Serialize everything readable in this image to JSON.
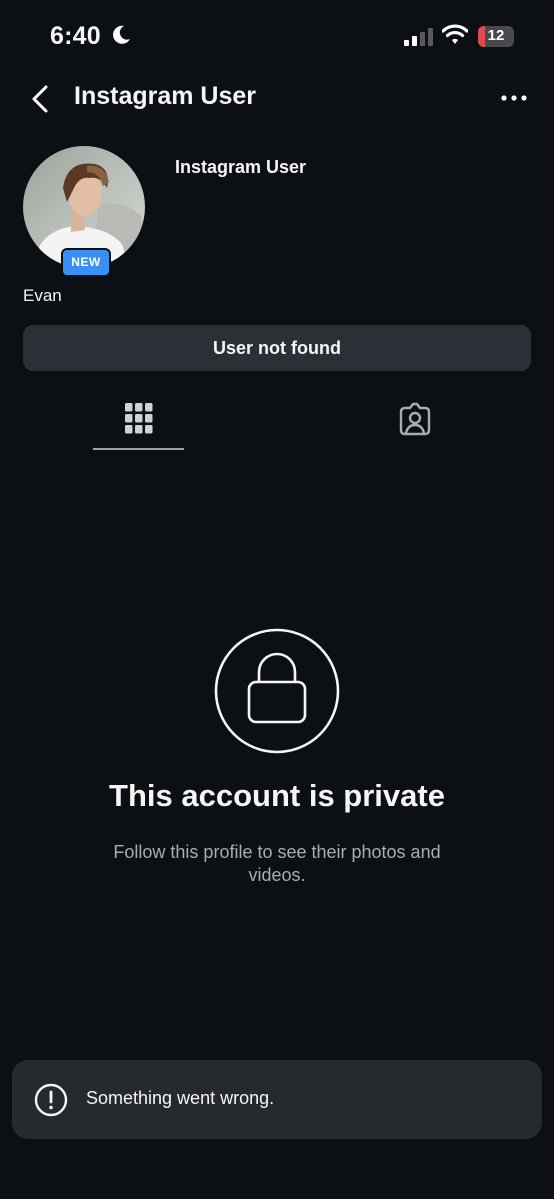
{
  "status_bar": {
    "time": "6:40",
    "battery_level": "12",
    "icons": [
      "moon-icon",
      "cellular-signal-icon",
      "wifi-icon",
      "battery-icon"
    ]
  },
  "header": {
    "title": "Instagram User",
    "icons": [
      "back-chevron-icon",
      "more-options-icon"
    ]
  },
  "profile": {
    "name": "Instagram User",
    "badge": "NEW",
    "bio_name": "Evan",
    "status_button": "User not found"
  },
  "tabs": [
    {
      "icon": "grid-icon",
      "selected": true
    },
    {
      "icon": "tagged-person-icon",
      "selected": false
    }
  ],
  "private": {
    "icon": "lock-icon",
    "title": "This account is private",
    "subtitle": "Follow this profile to see their photos and videos."
  },
  "toast": {
    "icon": "alert-circle-icon",
    "message": "Something went wrong."
  },
  "colors": {
    "background": "#0c1014",
    "button": "#2b3036",
    "badge": "#3a8ff5",
    "toast": "#262a2e",
    "muted_text": "#a8adb2",
    "battery_low": "#e5484d"
  }
}
